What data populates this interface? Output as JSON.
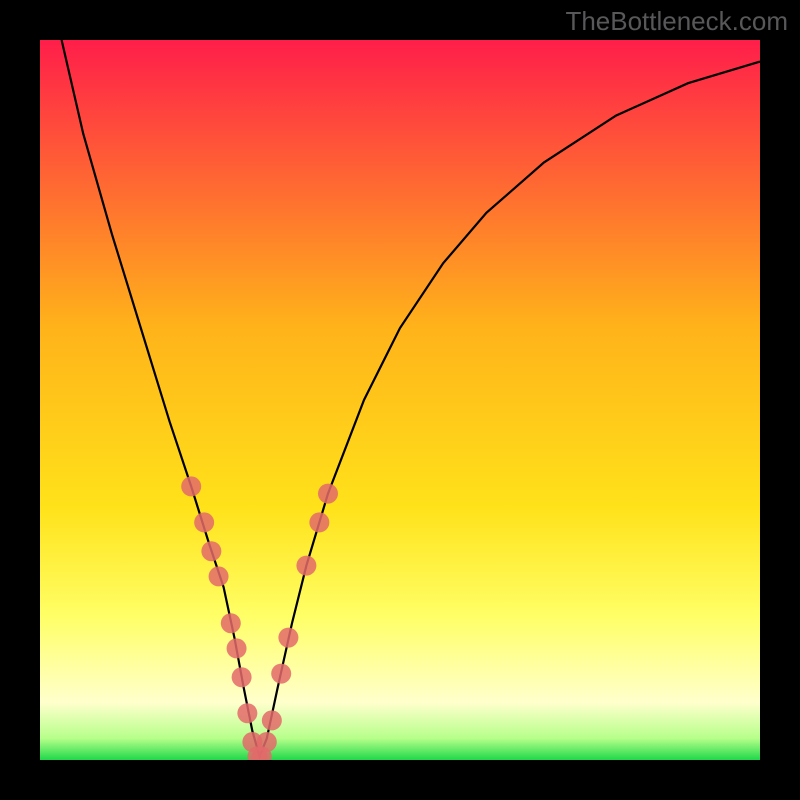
{
  "watermark": "TheBottleneck.com",
  "chart_data": {
    "type": "line",
    "title": "",
    "xlabel": "",
    "ylabel": "",
    "xlim": [
      0,
      100
    ],
    "ylim": [
      0,
      100
    ],
    "background_gradient": {
      "stops": [
        {
          "offset": 0,
          "color": "#ff1e4a"
        },
        {
          "offset": 40,
          "color": "#ffb31a"
        },
        {
          "offset": 65,
          "color": "#ffe21a"
        },
        {
          "offset": 80,
          "color": "#ffff66"
        },
        {
          "offset": 92,
          "color": "#ffffcc"
        },
        {
          "offset": 97,
          "color": "#b6ff8a"
        },
        {
          "offset": 100,
          "color": "#1fd84a"
        }
      ]
    },
    "series": [
      {
        "name": "bottleneck-curve",
        "color": "#000000",
        "x": [
          3,
          6,
          10,
          14,
          18,
          21,
          23.5,
          25.5,
          27,
          28.3,
          29.5,
          30.5,
          31.5,
          33,
          35,
          37,
          40,
          45,
          50,
          56,
          62,
          70,
          80,
          90,
          100
        ],
        "y": [
          100,
          87,
          73,
          60,
          47,
          38,
          30,
          24,
          17,
          10,
          4,
          0.5,
          3,
          10,
          19,
          27,
          37,
          50,
          60,
          69,
          76,
          83,
          89.5,
          94,
          97
        ]
      }
    ],
    "markers": {
      "name": "highlighted-points",
      "color": "#e36a6a",
      "radius": 10,
      "points": [
        {
          "x": 21.0,
          "y": 38
        },
        {
          "x": 22.8,
          "y": 33
        },
        {
          "x": 23.8,
          "y": 29
        },
        {
          "x": 24.8,
          "y": 25.5
        },
        {
          "x": 26.5,
          "y": 19
        },
        {
          "x": 27.3,
          "y": 15.5
        },
        {
          "x": 28.0,
          "y": 11.5
        },
        {
          "x": 28.8,
          "y": 6.5
        },
        {
          "x": 29.5,
          "y": 2.5
        },
        {
          "x": 30.2,
          "y": 0.5
        },
        {
          "x": 30.8,
          "y": 0.5
        },
        {
          "x": 31.5,
          "y": 2.5
        },
        {
          "x": 32.2,
          "y": 5.5
        },
        {
          "x": 33.5,
          "y": 12
        },
        {
          "x": 34.5,
          "y": 17
        },
        {
          "x": 37.0,
          "y": 27
        },
        {
          "x": 38.8,
          "y": 33
        },
        {
          "x": 40.0,
          "y": 37
        }
      ]
    }
  }
}
